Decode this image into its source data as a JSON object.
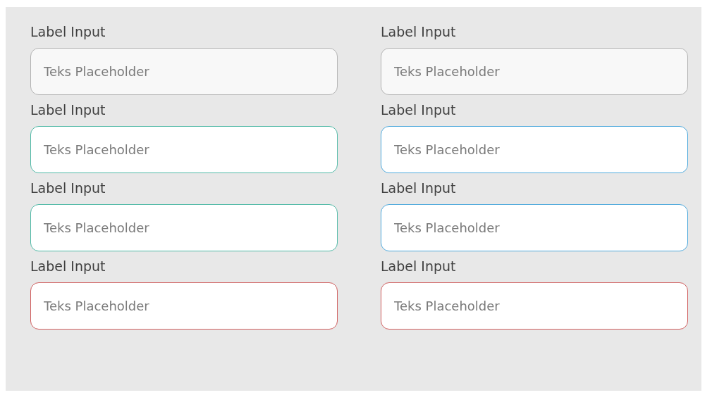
{
  "fields": [
    {
      "label": "Label Input",
      "placeholder": "Teks Placeholder",
      "kind": "default"
    },
    {
      "label": "Label Input",
      "placeholder": "Teks Placeholder",
      "kind": "default"
    },
    {
      "label": "Label Input",
      "placeholder": "Teks Placeholder",
      "kind": "success"
    },
    {
      "label": "Label Input",
      "placeholder": "Teks Placeholder",
      "kind": "info"
    },
    {
      "label": "Label Input",
      "placeholder": "Teks Placeholder",
      "kind": "success"
    },
    {
      "label": "Label Input",
      "placeholder": "Teks Placeholder",
      "kind": "info"
    },
    {
      "label": "Label Input",
      "placeholder": "Teks Placeholder",
      "kind": "error"
    },
    {
      "label": "Label Input",
      "placeholder": "Teks Placeholder",
      "kind": "error"
    }
  ]
}
